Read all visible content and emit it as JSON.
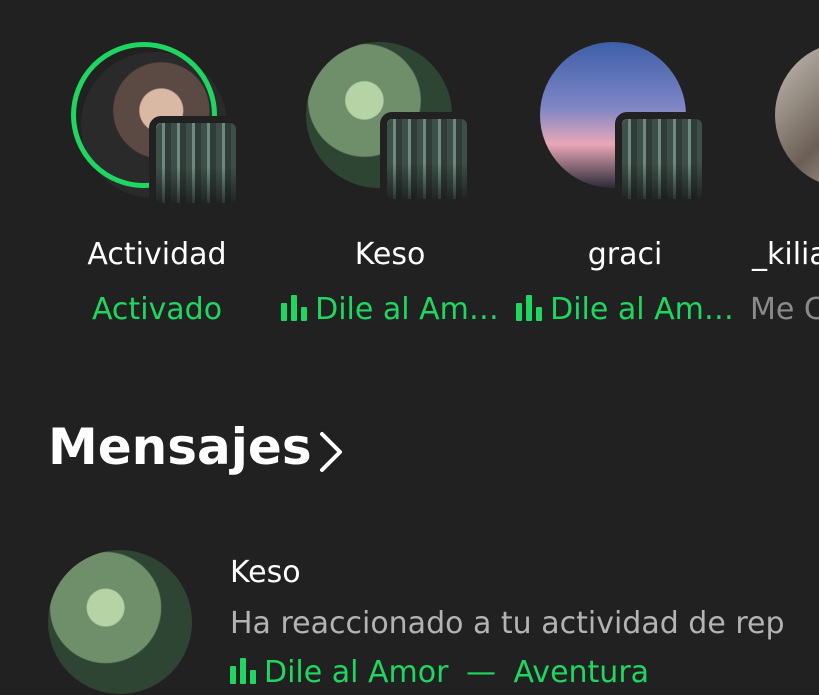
{
  "friends": [
    {
      "name": "Actividad",
      "status": "Activado",
      "status_is_track": false
    },
    {
      "name": "Keso",
      "status": "Dile al Am…",
      "status_is_track": true
    },
    {
      "name": "graci",
      "status": "Dile al Am…",
      "status_is_track": true
    },
    {
      "name": "_kilia",
      "status": "Me C",
      "status_is_track": false
    }
  ],
  "messages": {
    "title": "Mensajes",
    "items": [
      {
        "name": "Keso",
        "text": "Ha reaccionado a tu actividad de rep",
        "track": "Dile al Amor",
        "separator": "—",
        "artist": "Aventura"
      }
    ]
  },
  "colors": {
    "background": "#212121",
    "accent": "#1ed760",
    "text_primary": "#ffffff",
    "text_secondary": "#b3b3b3"
  },
  "icons": {
    "playing": "sound-bars-icon",
    "more": "chevron-right-icon"
  }
}
